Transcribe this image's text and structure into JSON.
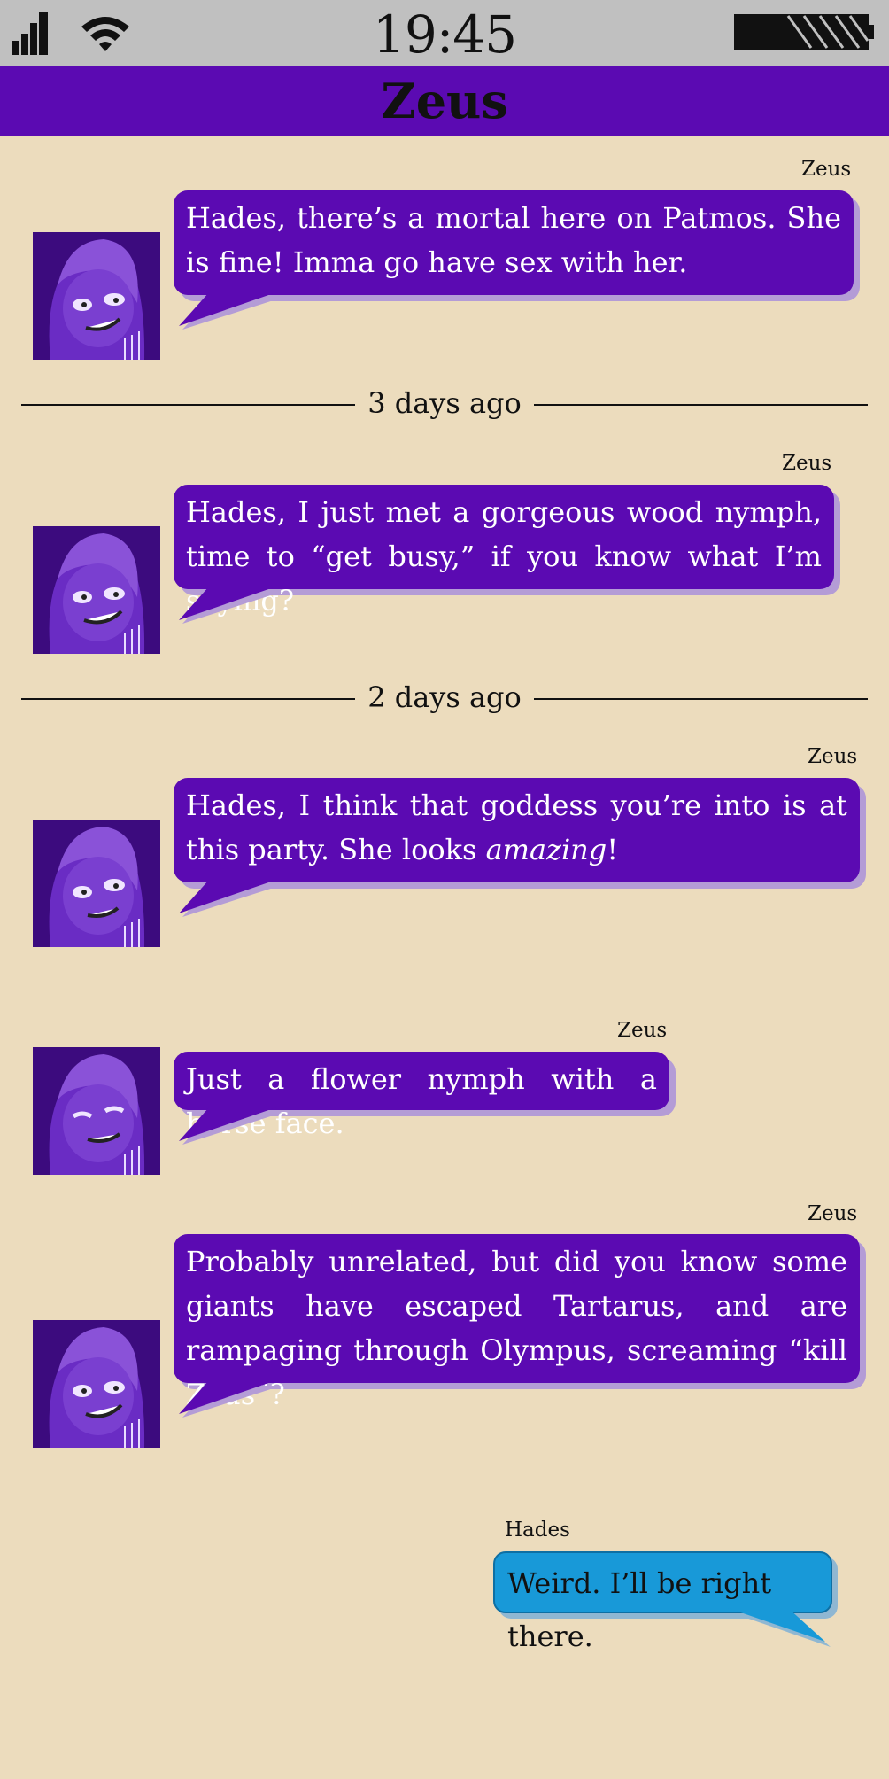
{
  "status_bar": {
    "time": "19:45",
    "icons": [
      "signal-icon",
      "wifi-icon",
      "battery-icon"
    ]
  },
  "header": {
    "title": "Zeus"
  },
  "messages": [
    {
      "sender": "Zeus",
      "text": "Hades, there’s a mortal here on Patmos. She is fine! Imma go have sex with her."
    },
    {
      "sender": "Zeus",
      "text": "Hades, I just met a gorgeous wood nymph, time to “get busy,” if you know what I’m saying?"
    },
    {
      "sender": "Zeus",
      "text_before": "Hades, I think that goddess you’re into is at this party. She looks ",
      "text_emph": "amazing",
      "text_after": "!"
    },
    {
      "sender": "Zeus",
      "text": "Just a flower nymph with a horse face."
    },
    {
      "sender": "Zeus",
      "text": "Probably unrelated, but did you know some giants have escaped Tartarus, and are rampaging through Olympus, screaming “kill Zeus”?"
    },
    {
      "sender": "Hades",
      "text": "Weird. I’ll be right there."
    }
  ],
  "dividers": [
    "3 days ago",
    "2 days ago"
  ],
  "colors": {
    "background": "#ecdcbd",
    "header": "#5b0ab2",
    "zeus_bubble": "#5b0ab2",
    "hades_bubble": "#1899d8",
    "status_bar": "#c0c0c0"
  }
}
